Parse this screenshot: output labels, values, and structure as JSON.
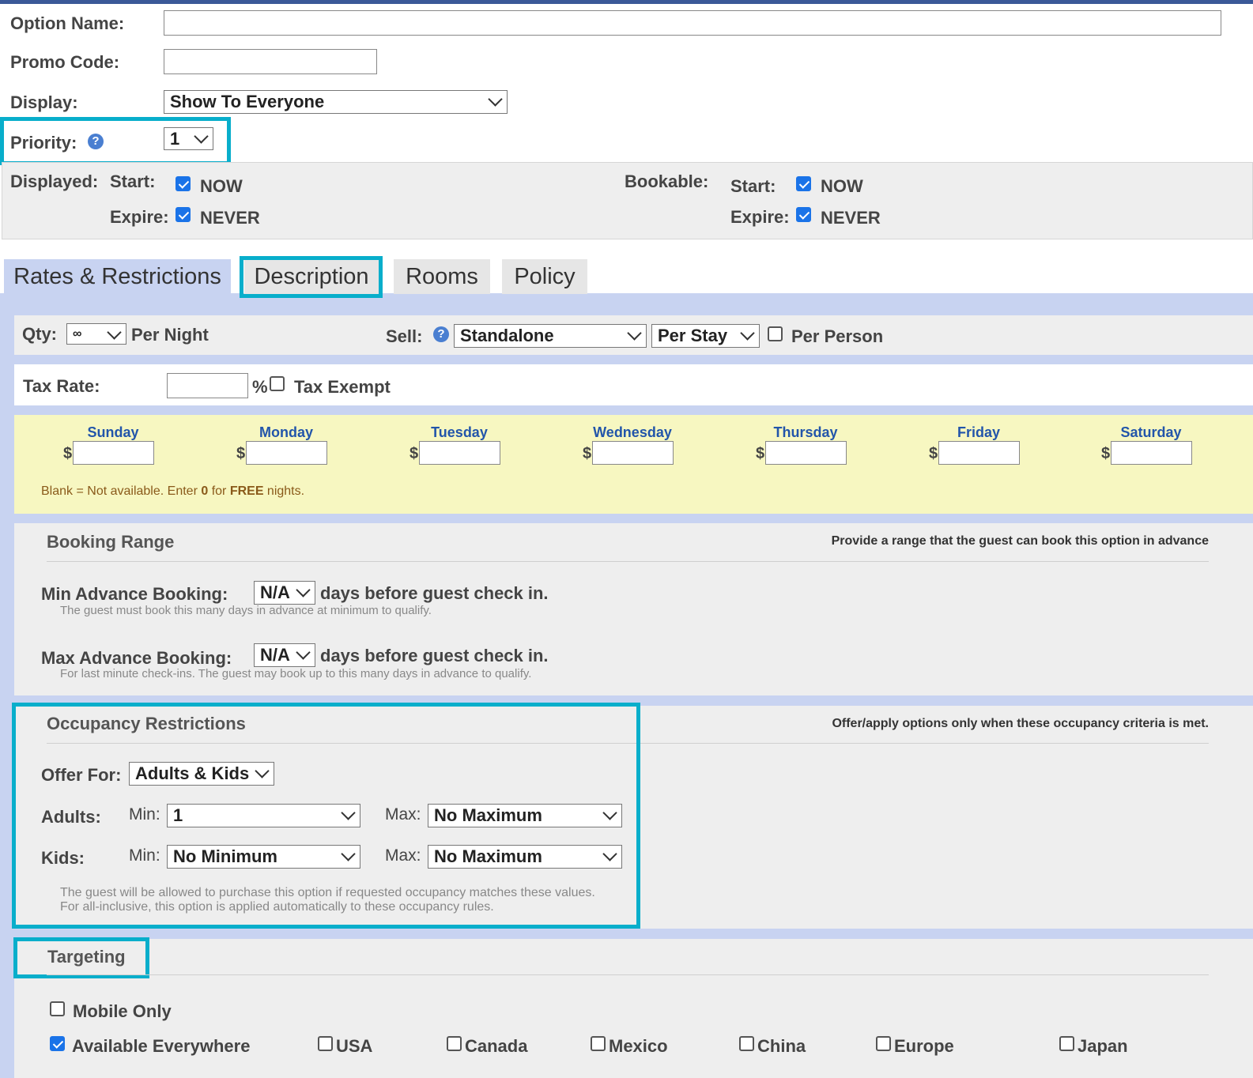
{
  "header": {
    "option_name_label": "Option Name:",
    "option_name_value": "",
    "promo_code_label": "Promo Code:",
    "promo_code_value": "",
    "display_label": "Display:",
    "display_value": "Show To Everyone",
    "priority_label": "Priority:",
    "priority_value": "1",
    "help_glyph": "?"
  },
  "dates": {
    "displayed_label": "Displayed:",
    "bookable_label": "Bookable:",
    "start_label": "Start:",
    "expire_label": "Expire:",
    "now_label": "NOW",
    "never_label": "NEVER",
    "displayed_start_now": true,
    "displayed_expire_never": true,
    "bookable_start_now": true,
    "bookable_expire_never": true
  },
  "tabs": [
    {
      "label": "Rates & Restrictions",
      "active": true
    },
    {
      "label": "Description",
      "active": false
    },
    {
      "label": "Rooms",
      "active": false
    },
    {
      "label": "Policy",
      "active": false
    }
  ],
  "sell_row": {
    "qty_label": "Qty:",
    "qty_value": "∞",
    "per_night_label": "Per Night",
    "sell_label": "Sell:",
    "sell_value": "Standalone",
    "per_value": "Per Stay",
    "per_person_label": "Per Person",
    "per_person_checked": false
  },
  "tax": {
    "label": "Tax Rate:",
    "value": "",
    "percent": "%",
    "exempt_label": "Tax Exempt",
    "exempt_checked": false
  },
  "rates": {
    "currency": "$",
    "days": [
      "Sunday",
      "Monday",
      "Tuesday",
      "Wednesday",
      "Thursday",
      "Friday",
      "Saturday"
    ],
    "note_prefix": "Blank = Not available. Enter ",
    "note_zero": "0",
    "note_mid": " for ",
    "note_free": "FREE",
    "note_suffix": " nights."
  },
  "booking_range": {
    "title": "Booking Range",
    "note": "Provide a range that the guest can book this option in advance",
    "min_label": "Min Advance Booking:",
    "min_value": "N/A",
    "min_suffix": "days before guest check in.",
    "min_help": "The guest must book this many days in advance at minimum to qualify.",
    "max_label": "Max Advance Booking:",
    "max_value": "N/A",
    "max_suffix": "days before guest check in.",
    "max_help": "For last minute check-ins. The guest may book up to this many days in advance to qualify."
  },
  "occupancy": {
    "title": "Occupancy Restrictions",
    "note": "Offer/apply options only when these occupancy criteria is met.",
    "offer_for_label": "Offer For:",
    "offer_for_value": "Adults & Kids",
    "adults_label": "Adults:",
    "kids_label": "Kids:",
    "min_label": "Min:",
    "max_label": "Max:",
    "adults_min": "1",
    "adults_max": "No Maximum",
    "kids_min": "No Minimum",
    "kids_max": "No Maximum",
    "help_line1": "The guest will be allowed to purchase this option if requested occupancy matches these values.",
    "help_line2": "For all-inclusive, this option is applied automatically to these occupancy rules."
  },
  "targeting": {
    "title": "Targeting",
    "mobile_only_label": "Mobile Only",
    "mobile_only_checked": false,
    "everywhere_label": "Available Everywhere",
    "everywhere_checked": true,
    "regions": [
      "USA",
      "Canada",
      "Mexico",
      "China",
      "Europe",
      "Japan"
    ]
  },
  "colors": {
    "highlight": "#08aecb",
    "tab_band": "#c8d3f1",
    "rates_bg": "#f7f7c1",
    "checkbox_on": "#1a73e8"
  }
}
